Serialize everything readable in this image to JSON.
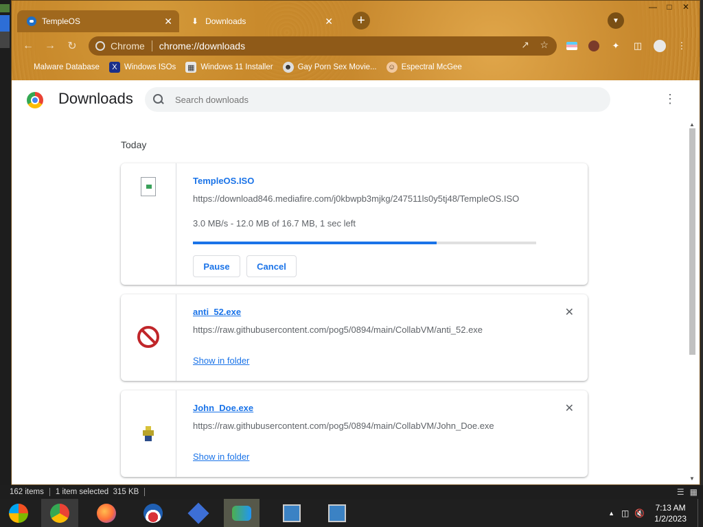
{
  "browser": {
    "tabs": [
      {
        "title": "TempleOS",
        "active": true
      },
      {
        "title": "Downloads",
        "active": false
      }
    ],
    "omnibox": {
      "site": "Chrome",
      "url": "chrome://downloads"
    },
    "bookmarks": [
      {
        "label": "Malware Database",
        "icon": "none"
      },
      {
        "label": "Windows ISOs",
        "icon": "x-icon"
      },
      {
        "label": "Windows 11 Installer",
        "icon": "installer-icon"
      },
      {
        "label": "Gay Porn Sex Movie...",
        "icon": "avatar-icon"
      },
      {
        "label": "Espectral McGee",
        "icon": "face-icon"
      }
    ]
  },
  "page": {
    "title": "Downloads",
    "search_placeholder": "Search downloads",
    "section": "Today",
    "downloads": [
      {
        "filename": "TempleOS.ISO",
        "source": "https://download846.mediafire.com/j0kbwpb3mjkg/247511ls0y5tj48/TempleOS.ISO",
        "status": "3.0 MB/s - 12.0 MB of 16.7 MB, 1 sec left",
        "progress_percent": 71,
        "pause_label": "Pause",
        "cancel_label": "Cancel"
      },
      {
        "filename": "anti_52.exe",
        "source": "https://raw.githubusercontent.com/pog5/0894/main/CollabVM/anti_52.exe",
        "show_label": "Show in folder"
      },
      {
        "filename": "John_Doe.exe",
        "source": "https://raw.githubusercontent.com/pog5/0894/main/CollabVM/John_Doe.exe",
        "show_label": "Show in folder"
      }
    ]
  },
  "explorer_status": {
    "items": "162 items",
    "selected": "1 item selected  315 KB"
  },
  "taskbar": {
    "time": "7:13 AM",
    "date": "1/2/2023"
  },
  "colors": {
    "accent": "#1a73e8",
    "frame": "#c8892f"
  }
}
